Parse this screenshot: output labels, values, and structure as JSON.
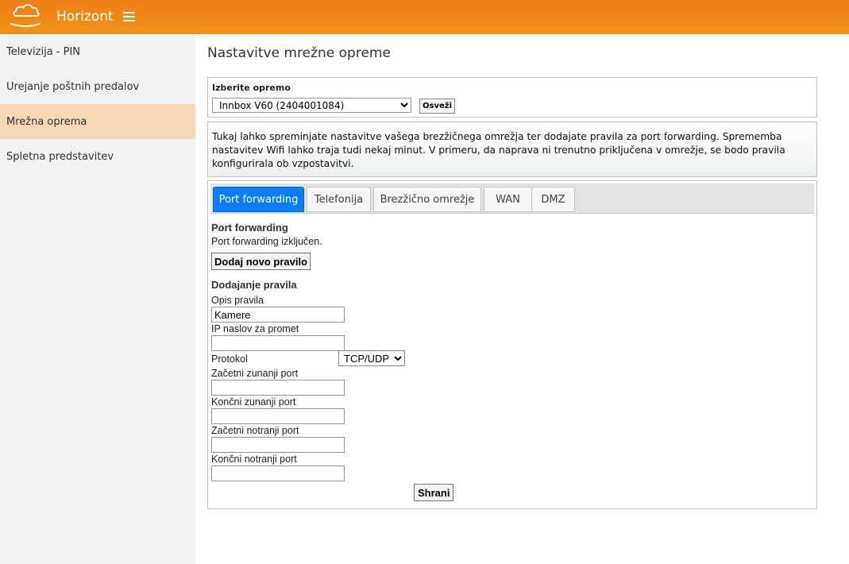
{
  "header": {
    "brand": "Horizont",
    "bg_color": "#f08518"
  },
  "sidebar": {
    "items": [
      {
        "label": "Televizija - PIN"
      },
      {
        "label": "Urejanje poštnih predalov"
      },
      {
        "label": "Mrežna oprema",
        "active": true
      },
      {
        "label": "Spletna predstavitev"
      }
    ]
  },
  "main": {
    "title": "Nastavitve mrežne opreme",
    "device": {
      "label": "Izberite opremo",
      "selected": "Innbox V60 (2404001084)",
      "refresh_label": "Osveži"
    },
    "info": "Tukaj lahko spreminjate nastavitve vašega brezžičnega omrežja ter dodajate pravila za port forwarding. Sprememba nastavitev Wifi lahko traja tudi nekaj minut. V primeru, da naprava ni trenutno priključena v omrežje, se bodo pravila konfigurirala ob vzpostavitvi.",
    "tabs": [
      {
        "label": "Port forwarding",
        "active": true
      },
      {
        "label": "Telefonija"
      },
      {
        "label": "Brezžično omrežje"
      },
      {
        "label": "WAN"
      },
      {
        "label": "DMZ"
      }
    ],
    "port_forwarding": {
      "title": "Port forwarding",
      "status": "Port forwarding izključen.",
      "add_button": "Dodaj novo pravilo",
      "form_title": "Dodajanje pravila",
      "fields": {
        "description": {
          "label": "Opis pravila",
          "value": "Kamere"
        },
        "ip": {
          "label": "IP naslov za promet",
          "value": ""
        },
        "protocol": {
          "label": "Protokol",
          "selected": "TCP/UDP"
        },
        "ext_start": {
          "label": "Začetni zunanji port",
          "value": ""
        },
        "ext_end": {
          "label": "Končni zunanji port",
          "value": ""
        },
        "int_start": {
          "label": "Začetni notranji port",
          "value": ""
        },
        "int_end": {
          "label": "Končni notranji port",
          "value": ""
        }
      },
      "save_button": "Shrani"
    }
  }
}
